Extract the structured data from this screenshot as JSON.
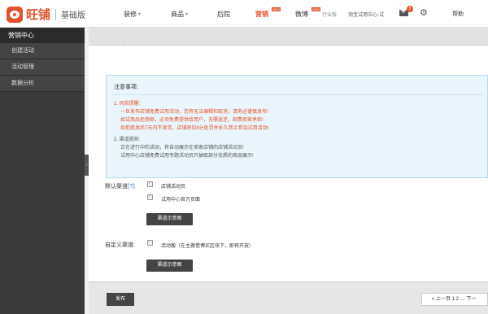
{
  "header": {
    "logo_text": "旺铺",
    "edition": "基础版",
    "nav": [
      {
        "label": "装修",
        "caret": "▾"
      },
      {
        "label": "商品",
        "caret": "▾"
      },
      {
        "label": "后院",
        "caret": ""
      },
      {
        "label": "营销",
        "caret": ""
      },
      {
        "label": "微博",
        "caret": ""
      }
    ],
    "new_badge_1": "NEW",
    "new_badge_2": "NEW",
    "industry_label": "行业版",
    "trial_center": "淘宝试用中心-试",
    "mail_count": "5",
    "help": "帮助"
  },
  "sidebar": {
    "title": "营销中心",
    "items": [
      {
        "label": "创建活动"
      },
      {
        "label": "活动管理"
      },
      {
        "label": "数据分析"
      }
    ],
    "collapse": "‹"
  },
  "main": {
    "cut_text": "…"
  },
  "notice": {
    "title": "注意事项:",
    "risk_title": "1. 风险提醒:",
    "risk_lines": [
      "一旦发布店铺免费试用活动，您将无法编辑和取消，请务必谨慎发布!",
      "如试用品拒绝邮，必须免费提供给用户，无需返还，邮费卖家承担!",
      "如拒绝发后7天内不发货，店铺将扣6分处罚并永久禁止参加试用活动!"
    ],
    "rule_title": "2. 渠道规则:",
    "rule_lines": [
      "正在进行中的活动，将自动展示在卖家店铺的店铺活动页!",
      "试用中心店铺免费试用专题活动页只抽取部分优质的商品展示!"
    ]
  },
  "default_channel": {
    "label": "默认渠道",
    "help": "[?]",
    "colon": ":",
    "options": [
      {
        "label": "店铺活动页",
        "checked": true
      },
      {
        "label": "试用中心官方页面",
        "checked": true
      }
    ],
    "demo_button": "渠道示意图"
  },
  "custom_channel": {
    "label": "自定义渠道:",
    "option": "活动搬（在主搬借博买区块下，即将开放）",
    "checked": false,
    "demo_button": "渠道示意图"
  },
  "footer": {
    "publish": "发布",
    "pager": "« 上一页 1 2 … 下一"
  }
}
